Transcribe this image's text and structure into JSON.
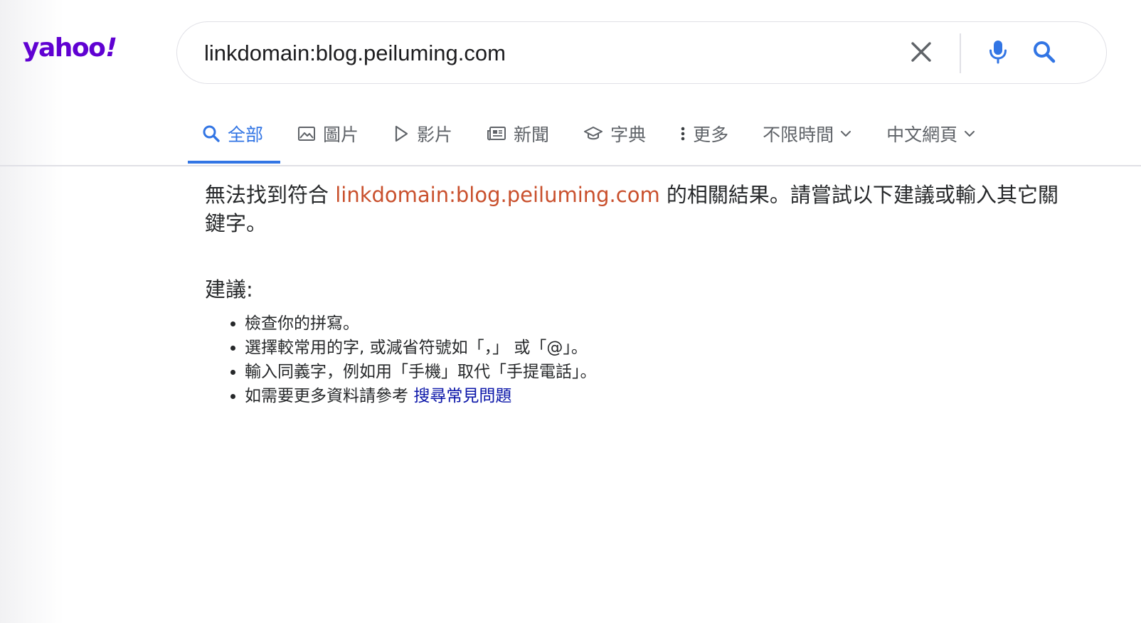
{
  "logo": {
    "text": "yahoo",
    "bang": "!",
    "color": "#6001d2"
  },
  "search": {
    "query": "linkdomain:blog.peiluming.com",
    "clear_icon": "close-icon",
    "mic_icon": "microphone-icon",
    "search_icon": "search-icon",
    "accent": "#3275e4"
  },
  "tabs": [
    {
      "label": "全部",
      "icon": "search-icon",
      "active": true
    },
    {
      "label": "圖片",
      "icon": "image-icon"
    },
    {
      "label": "影片",
      "icon": "play-icon"
    },
    {
      "label": "新聞",
      "icon": "newspaper-icon"
    },
    {
      "label": "字典",
      "icon": "graduation-cap-icon"
    },
    {
      "label": "更多",
      "icon": "more-vertical-icon"
    },
    {
      "label": "不限時間",
      "icon": "chevron-down-icon"
    },
    {
      "label": "中文網頁",
      "icon": "chevron-down-icon"
    }
  ],
  "message": {
    "prefix": "無法找到符合 ",
    "query": "linkdomain:blog.peiluming.com",
    "suffix": " 的相關結果。請嘗試以下建議或輸入其它關鍵字。",
    "query_color": "#c9502d"
  },
  "suggestions": {
    "title": "建議:",
    "items": [
      "檢查你的拼寫。",
      "選擇較常用的字, 或減省符號如「，」 或「@」。",
      "輸入同義字，例如用「手機」取代「手提電話」。"
    ],
    "last_prefix": "如需要更多資料請參考 ",
    "faq_link": "搜尋常見問題",
    "link_color": "#0a15a8"
  }
}
